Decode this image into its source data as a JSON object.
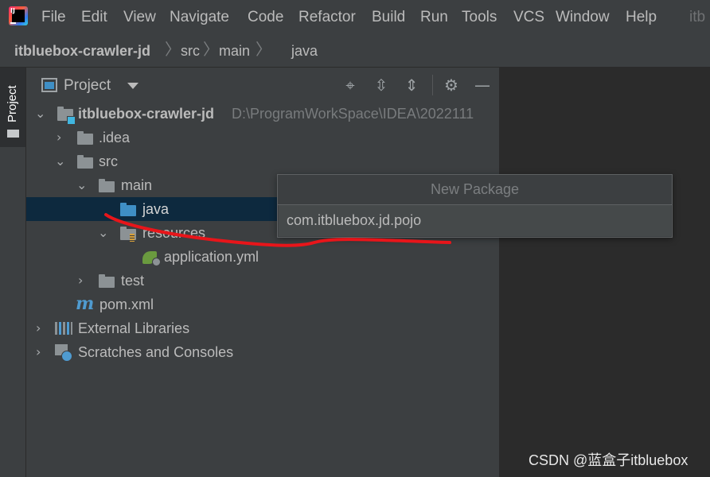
{
  "menu": {
    "items": [
      "File",
      "Edit",
      "View",
      "Navigate",
      "Code",
      "Refactor",
      "Build",
      "Run",
      "Tools",
      "VCS",
      "Window",
      "Help"
    ],
    "window_title": "itb",
    "logo_text": "IJ"
  },
  "breadcrumb": [
    "itbluebox-crawler-jd",
    "src",
    "main",
    "java"
  ],
  "tool_window": {
    "tab_label": "Project"
  },
  "project_panel": {
    "title": "Project",
    "header_icons": [
      "locate-icon",
      "expand-all-icon",
      "collapse-all-icon",
      "settings-icon",
      "minimize-icon"
    ]
  },
  "tree": {
    "root": {
      "label": "itbluebox-crawler-jd",
      "path": "D:\\ProgramWorkSpace\\IDEA\\2022111"
    },
    "idea": ".idea",
    "src": "src",
    "main": "main",
    "java": "java",
    "resources": "resources",
    "application_yml": "application.yml",
    "test": "test",
    "pom": "pom.xml",
    "external_libraries": "External Libraries",
    "scratches": "Scratches and Consoles"
  },
  "popup": {
    "title": "New Package",
    "input_value": "com.itbluebox.jd.pojo"
  },
  "watermark": "CSDN @蓝盒子itbluebox",
  "colors": {
    "background": "#3c3f41",
    "editor": "#2b2b2b",
    "selection": "#0d293e",
    "folder_blue": "#3f8fc5",
    "annotation_red": "#e8151a"
  }
}
